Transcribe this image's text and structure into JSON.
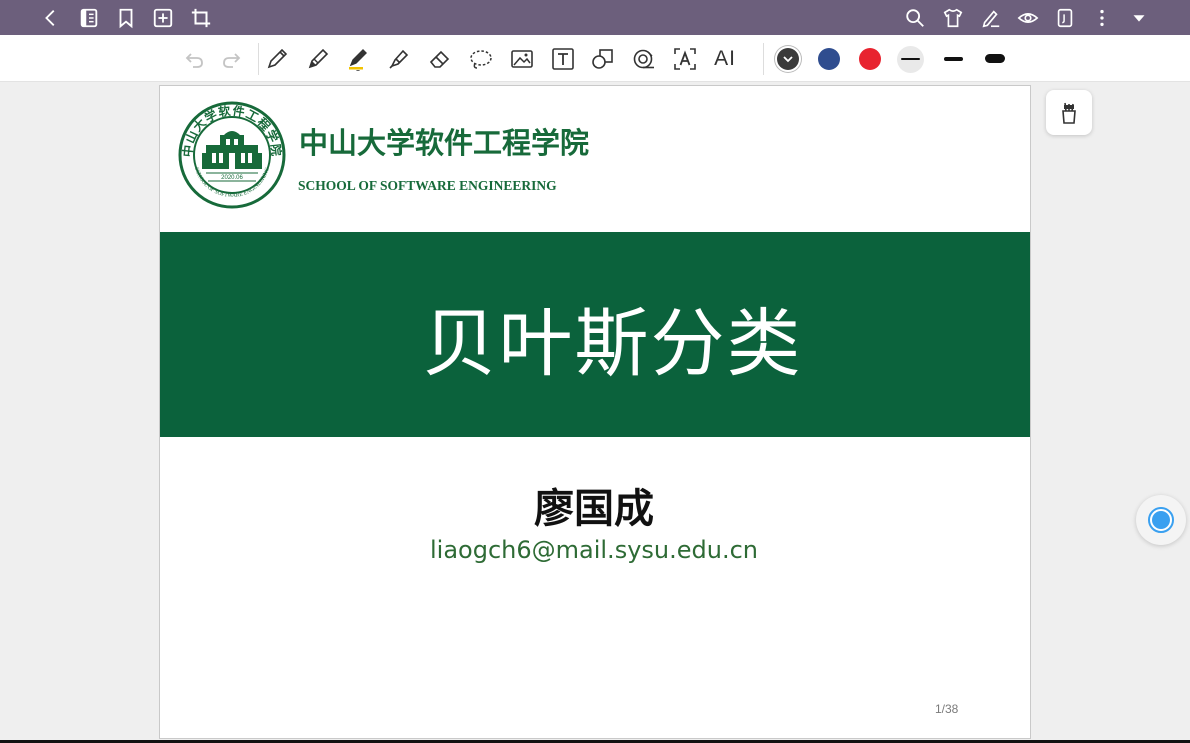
{
  "topbar": {
    "left_icons": [
      "back-icon",
      "outline-icon",
      "bookmark-icon",
      "add-page-icon",
      "crop-icon"
    ],
    "right_icons": [
      "search-icon",
      "theme-shirt-icon",
      "handwriting-icon",
      "view-eye-icon",
      "page-mode-icon",
      "more-icon",
      "dropdown-icon"
    ]
  },
  "toolbar": {
    "tools": [
      "undo-icon",
      "redo-icon",
      "ballpen-icon",
      "pencil-icon",
      "highlighter-pen-icon",
      "marker-icon",
      "eraser-icon",
      "lasso-icon",
      "image-icon",
      "textbox-icon",
      "shape-icon",
      "tape-icon",
      "ocr-icon",
      "ai-icon"
    ],
    "ai_label": "AI",
    "colors": [
      "#3a3a3a",
      "#2f4d8f",
      "#e8232f"
    ],
    "active_stroke": "thin"
  },
  "slide": {
    "school_cn": "中山大学软件工程学院",
    "school_en": "SCHOOL OF SOFTWARE ENGINEERING",
    "logo_text": "SCHOOL OF SOFTWARE ENGINEERING",
    "logo_year": "2020.06",
    "title": "贝叶斯分类",
    "author": "廖国成",
    "email": "liaogch6@mail.sysu.edu.cn",
    "page": "1/38",
    "brand_green": "#0b623c"
  }
}
